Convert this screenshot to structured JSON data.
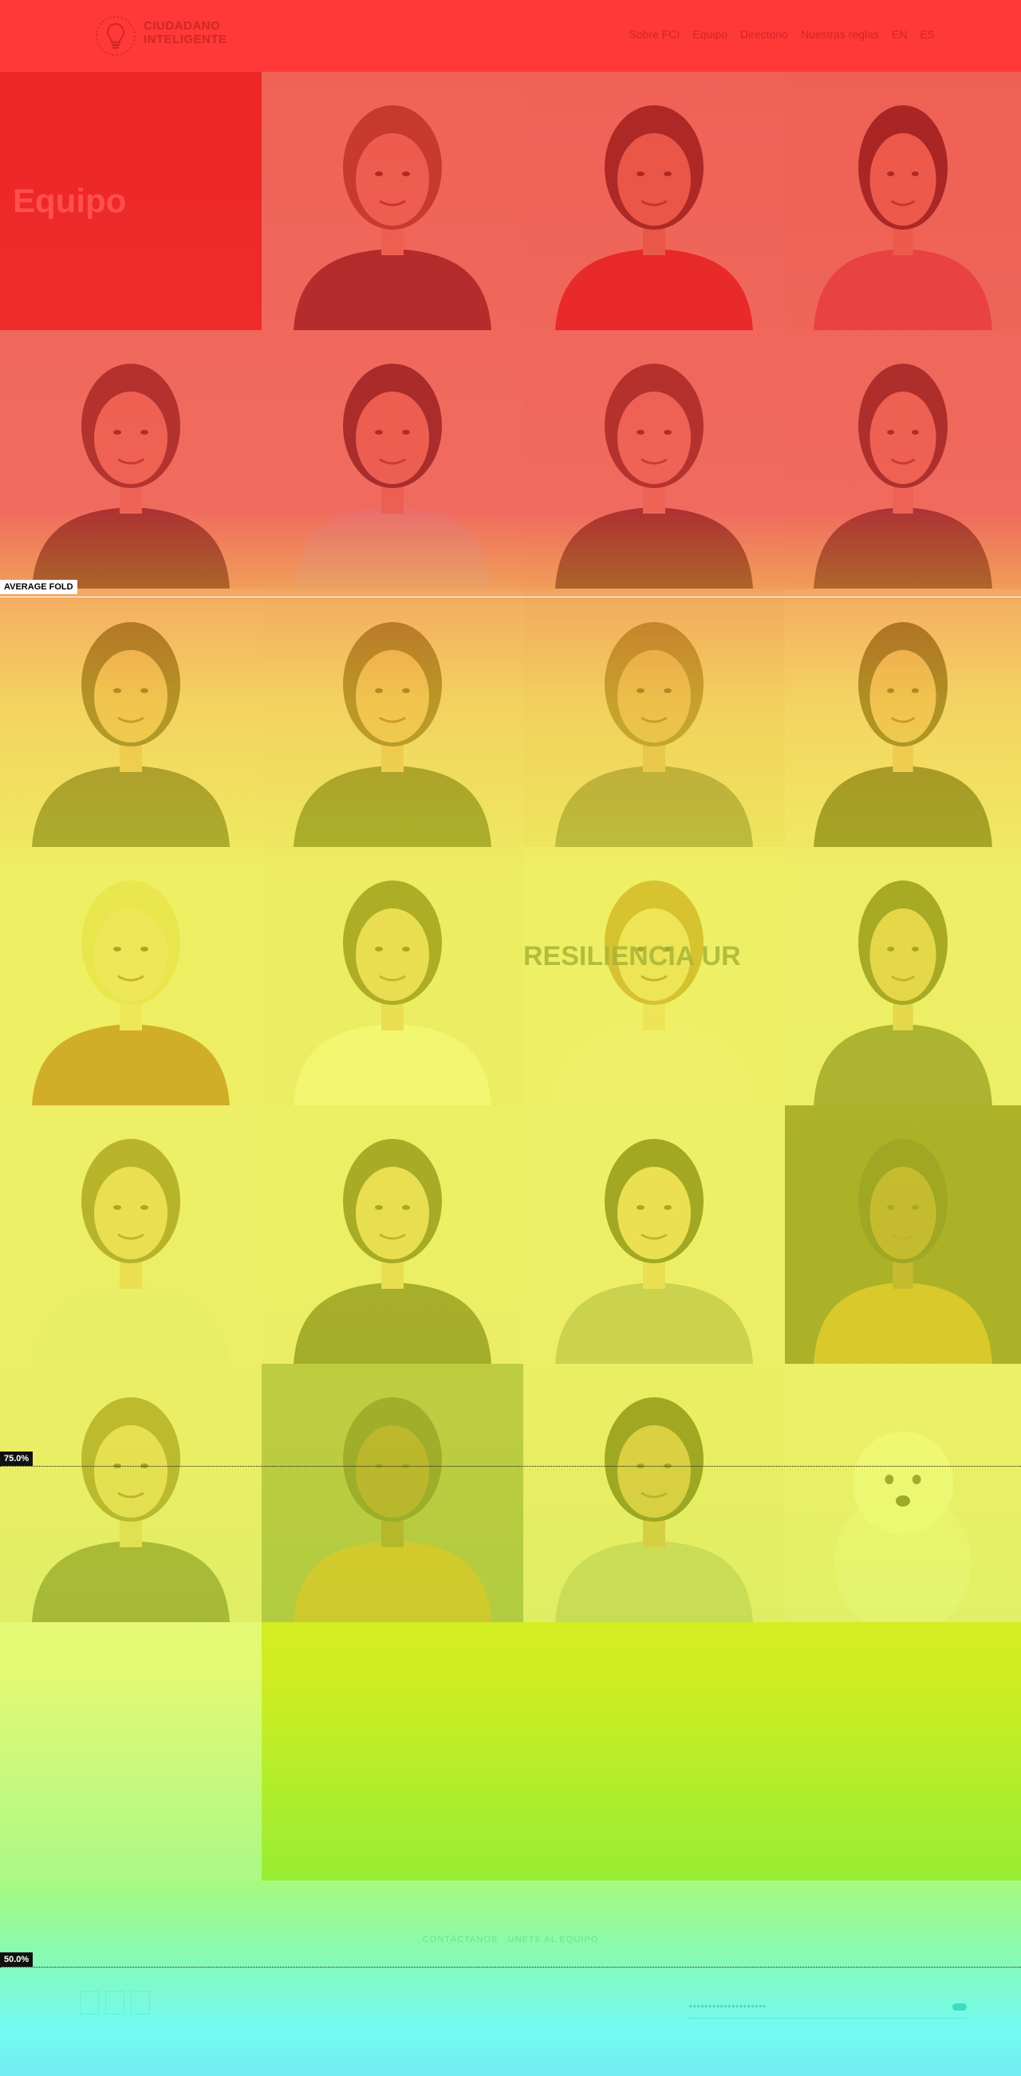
{
  "header": {
    "logo_line1": "CIUDADANO",
    "logo_line2": "INTELIGENTE",
    "nav": [
      "Sobre FCI",
      "Equipo",
      "Directorio",
      "Nuestras reglas",
      "EN",
      "ES"
    ]
  },
  "main": {
    "title": "Equipo"
  },
  "portraits": [
    {
      "bg": "#d9b99a",
      "shirt": "#3a1f1f",
      "hair": "#6d4a2b",
      "skin": "#d4a583"
    },
    {
      "bg": "#d8b89a",
      "shirt": "#c21a1a",
      "hair": "#2a1d15",
      "skin": "#c8946e"
    },
    {
      "bg": "#d6b493",
      "shirt": "#c45a5a",
      "hair": "#1f1712",
      "skin": "#cf9c78"
    },
    {
      "bg": "#d9bc9c",
      "shirt": "#262626",
      "hair": "#3b2a1f",
      "skin": "#d4a47f"
    },
    {
      "bg": "#d9bc9c",
      "shirt": "#c9c4bc",
      "hair": "#1e1a17",
      "skin": "#d09c7a"
    },
    {
      "bg": "#d8b99c",
      "shirt": "#2b2424",
      "hair": "#3a291d",
      "skin": "#d5a585"
    },
    {
      "bg": "#d7b899",
      "shirt": "#2a2a2a",
      "hair": "#2a2019",
      "skin": "#d3a27e"
    },
    {
      "bg": "#e2cfb8",
      "shirt": "#313131",
      "hair": "#3a2a20",
      "skin": "#d9aa87"
    },
    {
      "bg": "#e0cdb6",
      "shirt": "#2e3a2a",
      "hair": "#4b3323",
      "skin": "#d8a987"
    },
    {
      "bg": "#ddc8ae",
      "shirt": "#5f5a55",
      "hair": "#6b4c30",
      "skin": "#cc9d7d"
    },
    {
      "bg": "#e3d1bc",
      "shirt": "#1f1f1f",
      "hair": "#2f211a",
      "skin": "#d8a888"
    },
    {
      "bg": "#e4d4bf",
      "shirt": "#9b2a24",
      "hair": "#d7bd84",
      "skin": "#e3bfa1"
    },
    {
      "bg": "#e1cfbb",
      "shirt": "#efe8df",
      "hair": "#3a281d",
      "skin": "#d6a88a"
    },
    {
      "bg": "#e5d5c1",
      "shirt": "#e8d9c9",
      "hair": "#a65e36",
      "skin": "#e1b89b"
    },
    {
      "bg": "#e1d3c3",
      "shirt": "#3a3a3a",
      "hair": "#2a1f19",
      "skin": "#c9987a"
    },
    {
      "bg": "#e4d6c6",
      "shirt": "#d8d1c6",
      "hair": "#5a3b28",
      "skin": "#dcac8c"
    },
    {
      "bg": "#e2d2c0",
      "shirt": "#2a2a2a",
      "hair": "#2c221c",
      "skin": "#d9ab8b"
    },
    {
      "bg": "#e4d5c5",
      "shirt": "#8a8a86",
      "hair": "#1f1915",
      "skin": "#dcae90"
    },
    {
      "bg": "#3a3520",
      "shirt": "#b3702a",
      "hair": "#1b1714",
      "skin": "#7a5034"
    },
    {
      "bg": "#e2d3c3",
      "shirt": "#4a4a4a",
      "hair": "#6a4a34",
      "skin": "#d9ad8e"
    },
    {
      "bg": "#6a7a63",
      "shirt": "#b47531",
      "hair": "#1e2a2a",
      "skin": "#6a432e"
    },
    {
      "bg": "#e0d1bf",
      "shirt": "#a3a39c",
      "hair": "#1e1915",
      "skin": "#b98466"
    },
    {
      "bg": "#e4d7c7",
      "shirt": "#e9e3da",
      "hair": "#efece5",
      "skin": "#f2efe8"
    },
    {
      "bg": "#e7dccf",
      "shirt": "#e7dccf",
      "hair": "#e6d6bd",
      "skin": "#eadfcc"
    }
  ],
  "speaker_text": "RESILIENCIA UR",
  "footer": {
    "links": [
      "CONTÁCTANOS",
      "ÚNETE AL EQUIPO"
    ],
    "newsletter_placeholder": "••••••••••••••••••••"
  },
  "heatmap": {
    "fold_label": "AVERAGE FOLD",
    "markers": [
      "75.0%",
      "50.0%"
    ]
  }
}
